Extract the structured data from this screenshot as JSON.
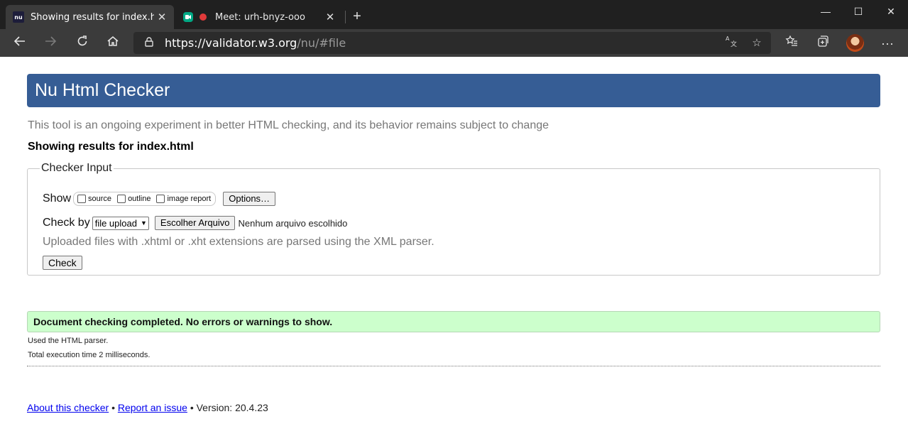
{
  "browser": {
    "tabs": [
      {
        "title": "Showing results for index.html -",
        "favicon": "nu",
        "active": true
      },
      {
        "title": "Meet: urh-bnyz-ooo",
        "favicon": "meet",
        "active": false
      }
    ],
    "new_tab_icon": "plus-icon",
    "window_controls": {
      "minimize": "—",
      "maximize": "☐",
      "close": "✕"
    },
    "url": {
      "host": "https://validator.w3.org",
      "path": "/nu/#file"
    },
    "toolbar_icons": [
      "back-arrow-icon",
      "forward-arrow-icon",
      "refresh-icon",
      "home-icon",
      "lock-icon",
      "translate-icon",
      "star-icon",
      "favorites-icon",
      "collections-icon",
      "profile-avatar",
      "more-icon"
    ]
  },
  "page": {
    "header": "Nu Html Checker",
    "tagline": "This tool is an ongoing experiment in better HTML checking, and its behavior remains subject to change",
    "results_for": "Showing results for index.html",
    "checker_input": {
      "legend": "Checker Input",
      "show_label": "Show",
      "show_options": [
        "source",
        "outline",
        "image report"
      ],
      "options_button": "Options…",
      "check_by_label": "Check by",
      "check_by_value": "file upload",
      "file_button": "Escolher Arquivo",
      "no_file": "Nenhum arquivo escolhido",
      "xml_note": "Uploaded files with .xhtml or .xht extensions are parsed using the XML parser.",
      "check_button": "Check"
    },
    "success_message": "Document checking completed. No errors or warnings to show.",
    "parser_note": "Used the HTML parser.",
    "exec_time": "Total execution time 2 milliseconds.",
    "footer": {
      "about": "About this checker",
      "sep1": "•",
      "report": "Report an issue",
      "version": "• Version: 20.4.23"
    }
  },
  "colors": {
    "header_bg": "#365d95",
    "success_bg": "#ccffcc",
    "link": "#0000ee"
  }
}
